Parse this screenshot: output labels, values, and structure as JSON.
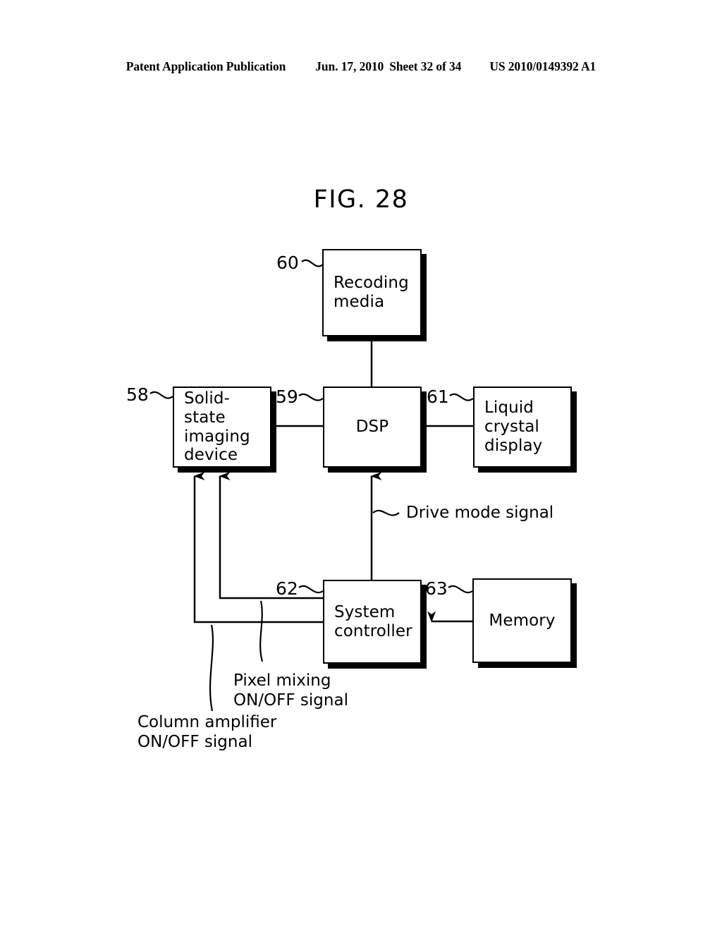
{
  "header": {
    "publication": "Patent Application Publication",
    "date": "Jun. 17, 2010",
    "sheet": "Sheet 32 of 34",
    "number": "US 2010/0149392 A1"
  },
  "figure": {
    "title": "FIG. 28"
  },
  "diagram": {
    "type": "block-diagram",
    "blocks": [
      {
        "ref": "60",
        "label": "Recoding\nmedia",
        "align": "left"
      },
      {
        "ref": "58",
        "label": "Solid-state\nimaging\ndevice",
        "align": "left"
      },
      {
        "ref": "59",
        "label": "DSP",
        "align": "center"
      },
      {
        "ref": "61",
        "label": "Liquid\ncrystal\ndisplay",
        "align": "left"
      },
      {
        "ref": "62",
        "label": "System\ncontroller",
        "align": "left"
      },
      {
        "ref": "63",
        "label": "Memory",
        "align": "center"
      }
    ],
    "annotations": [
      {
        "id": "drive-mode",
        "label": "Drive mode signal"
      },
      {
        "id": "pixel-mixing",
        "label": "Pixel mixing\nON/OFF signal"
      },
      {
        "id": "column-amplifier",
        "label": "Column amplifier\nON/OFF signal"
      }
    ],
    "connections": [
      {
        "from": "60",
        "to": "59",
        "arrow": "none"
      },
      {
        "from": "58",
        "to": "59",
        "arrow": "none"
      },
      {
        "from": "59",
        "to": "61",
        "arrow": "none"
      },
      {
        "from": "62",
        "to": "59",
        "arrow": "to"
      },
      {
        "from": "63",
        "to": "62",
        "arrow": "to"
      },
      {
        "from": "62",
        "to": "58",
        "arrow": "to",
        "signal": "Pixel mixing ON/OFF signal"
      },
      {
        "from": "62",
        "to": "58",
        "arrow": "to",
        "signal": "Column amplifier ON/OFF signal"
      }
    ],
    "colors": {
      "line": "#000000",
      "fill": "#ffffff"
    }
  }
}
